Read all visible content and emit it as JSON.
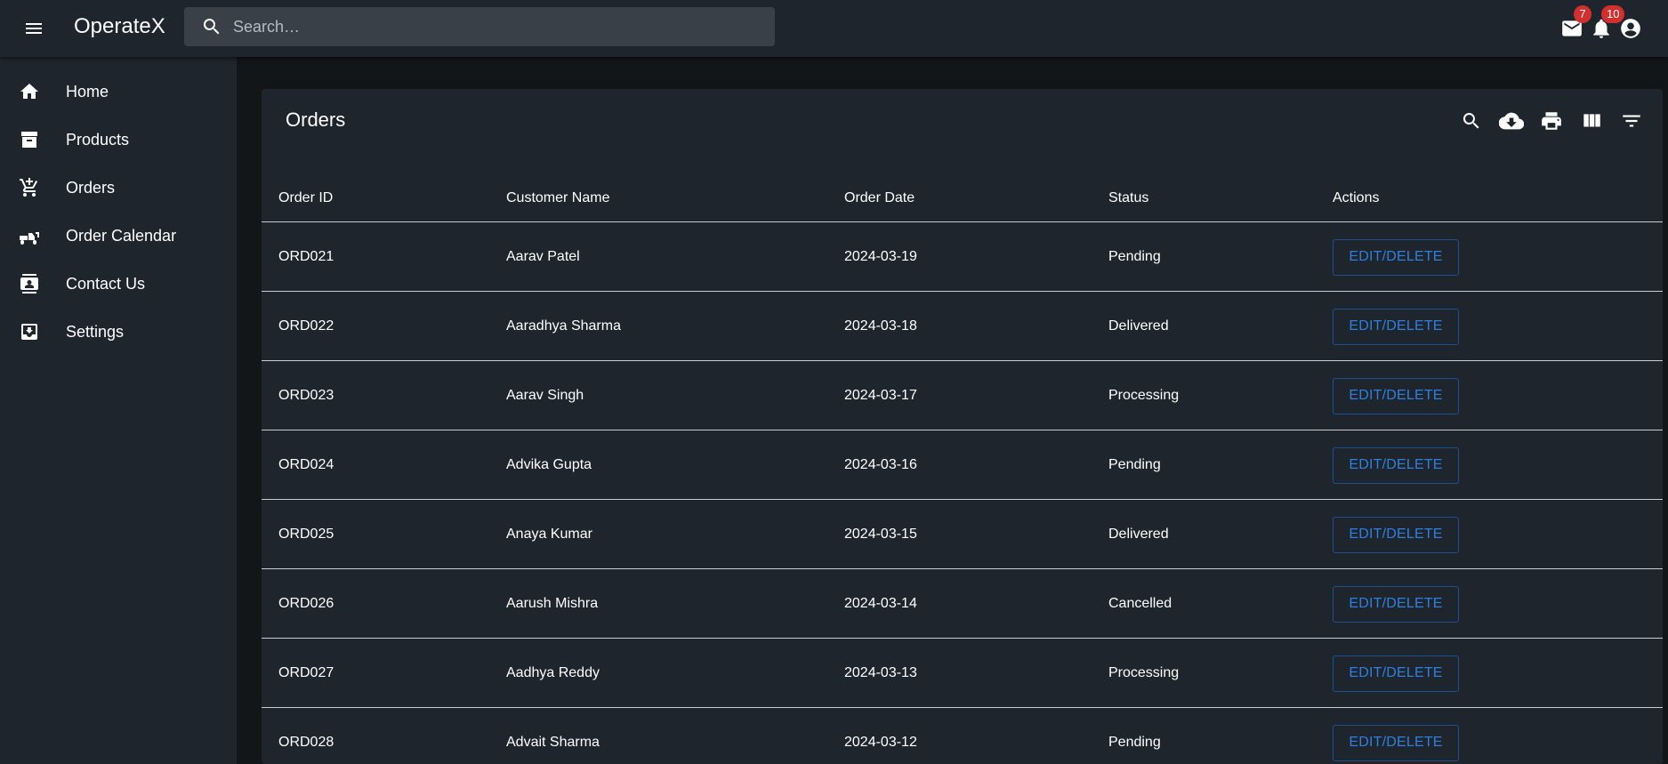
{
  "app": {
    "title": "OperateX"
  },
  "search": {
    "placeholder": "Search…"
  },
  "header": {
    "mail_badge": "7",
    "notifications_badge": "10"
  },
  "sidebar": {
    "items": [
      {
        "label": "Home",
        "icon": "home-icon"
      },
      {
        "label": "Products",
        "icon": "archive-icon"
      },
      {
        "label": "Orders",
        "icon": "cart-icon"
      },
      {
        "label": "Order Calendar",
        "icon": "delivery-icon"
      },
      {
        "label": "Contact Us",
        "icon": "contact-icon"
      },
      {
        "label": "Settings",
        "icon": "inbox-download-icon"
      }
    ]
  },
  "panel": {
    "title": "Orders",
    "toolbar_icons": [
      "search-icon",
      "cloud-download-icon",
      "print-icon",
      "view-columns-icon",
      "filter-icon"
    ]
  },
  "table": {
    "columns": [
      "Order ID",
      "Customer Name",
      "Order Date",
      "Status",
      "Actions"
    ],
    "action_label": "EDIT/DELETE",
    "rows": [
      {
        "id": "ORD021",
        "name": "Aarav Patel",
        "date": "2024-03-19",
        "status": "Pending"
      },
      {
        "id": "ORD022",
        "name": "Aaradhya Sharma",
        "date": "2024-03-18",
        "status": "Delivered"
      },
      {
        "id": "ORD023",
        "name": "Aarav Singh",
        "date": "2024-03-17",
        "status": "Processing"
      },
      {
        "id": "ORD024",
        "name": "Advika Gupta",
        "date": "2024-03-16",
        "status": "Pending"
      },
      {
        "id": "ORD025",
        "name": "Anaya Kumar",
        "date": "2024-03-15",
        "status": "Delivered"
      },
      {
        "id": "ORD026",
        "name": "Aarush Mishra",
        "date": "2024-03-14",
        "status": "Cancelled"
      },
      {
        "id": "ORD027",
        "name": "Aadhya Reddy",
        "date": "2024-03-13",
        "status": "Processing"
      },
      {
        "id": "ORD028",
        "name": "Advait Sharma",
        "date": "2024-03-12",
        "status": "Pending"
      }
    ]
  },
  "colors": {
    "appbar": "#1f252c",
    "background": "#121619",
    "accent": "#2f7fe0",
    "badge": "#d32f2f"
  }
}
